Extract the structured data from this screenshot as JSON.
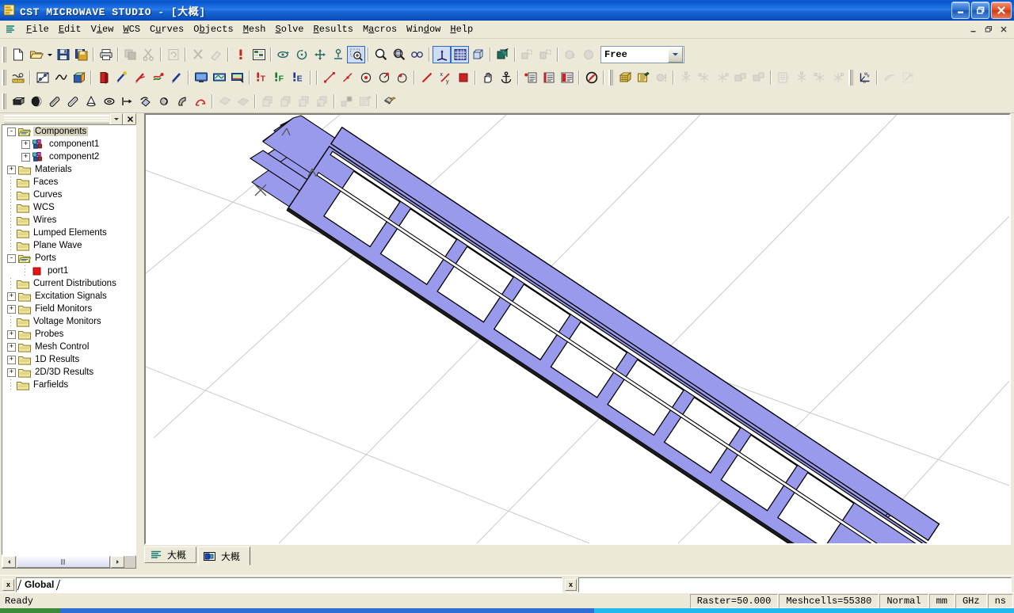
{
  "window": {
    "title": "CST MICROWAVE STUDIO - [大概]",
    "icon": "cst-logo-icon",
    "controls": {
      "minimize": "_",
      "restore": "❐",
      "close": "✕"
    },
    "mdi_controls": {
      "minimize": "_",
      "restore": "❐",
      "close": "✕"
    }
  },
  "menubar": {
    "sys_icon": "cst-document-icon",
    "items": [
      {
        "label": "File",
        "accel": "F"
      },
      {
        "label": "Edit",
        "accel": "E"
      },
      {
        "label": "View",
        "accel": "i"
      },
      {
        "label": "WCS",
        "accel": "W"
      },
      {
        "label": "Curves",
        "accel": "u"
      },
      {
        "label": "Objects",
        "accel": "b"
      },
      {
        "label": "Mesh",
        "accel": "M"
      },
      {
        "label": "Solve",
        "accel": "S"
      },
      {
        "label": "Results",
        "accel": "R"
      },
      {
        "label": "Macros",
        "accel": "a"
      },
      {
        "label": "Window",
        "accel": "d"
      },
      {
        "label": "Help",
        "accel": "H"
      }
    ]
  },
  "toolbar_main": {
    "buttons": [
      {
        "name": "new-file-icon",
        "tip": "New",
        "enabled": true
      },
      {
        "name": "open-file-icon",
        "tip": "Open",
        "enabled": true
      },
      {
        "name": "open-dropdown-icon",
        "tip": "Open recent",
        "enabled": true
      },
      {
        "name": "save-icon",
        "tip": "Save",
        "enabled": true
      },
      {
        "name": "save-project-icon",
        "tip": "Save project",
        "enabled": true
      },
      {
        "name": "print-icon",
        "tip": "Print",
        "enabled": true
      },
      {
        "name": "copy-view-icon",
        "tip": "Copy view",
        "enabled": false
      },
      {
        "name": "cut-icon",
        "tip": "Cut",
        "enabled": false
      },
      {
        "name": "refresh-icon",
        "tip": "Refresh",
        "enabled": false
      },
      {
        "name": "delete-icon",
        "tip": "Delete",
        "enabled": false
      },
      {
        "name": "undo-icon",
        "tip": "Undo",
        "enabled": false
      },
      {
        "name": "info-icon",
        "tip": "Information",
        "enabled": true
      },
      {
        "name": "parameter-list-icon",
        "tip": "Parametric",
        "enabled": true
      },
      {
        "name": "rotate-view-icon",
        "tip": "Rotate",
        "enabled": true
      },
      {
        "name": "rotate-plane-icon",
        "tip": "Rotate in plane",
        "enabled": true
      },
      {
        "name": "pan-view-icon",
        "tip": "Pan",
        "enabled": true
      },
      {
        "name": "zoom-scale-icon",
        "tip": "Scale",
        "enabled": true
      },
      {
        "name": "zoom-region-icon",
        "tip": "Zoom region",
        "enabled": true,
        "selected": true
      },
      {
        "name": "zoom-in-icon",
        "tip": "Zoom in",
        "enabled": true
      },
      {
        "name": "zoom-reset-icon",
        "tip": "Reset view",
        "enabled": true
      },
      {
        "name": "stereo-view-icon",
        "tip": "Stereo",
        "enabled": true
      },
      {
        "name": "axes-icon",
        "tip": "Show axes",
        "enabled": true,
        "selected": true
      },
      {
        "name": "grid-icon",
        "tip": "Working plane",
        "enabled": true,
        "selected": true
      },
      {
        "name": "wireframe-icon",
        "tip": "Wire frame",
        "enabled": true
      },
      {
        "name": "cutplane-icon",
        "tip": "Cutting plane",
        "enabled": true
      },
      {
        "name": "group-icon",
        "tip": "Group",
        "enabled": false
      },
      {
        "name": "ungroup-icon",
        "tip": "Ungroup",
        "enabled": false
      },
      {
        "name": "transparent-icon",
        "tip": "Transparency",
        "enabled": false
      },
      {
        "name": "shaded-icon",
        "tip": "Shaded view",
        "enabled": false
      }
    ],
    "snap_combo": {
      "value": "Free",
      "label": "snap-mode"
    }
  },
  "toolbar_simulation": {
    "buttons": [
      {
        "name": "measure-distance-icon",
        "enabled": true
      },
      {
        "name": "background-material-icon",
        "enabled": true
      },
      {
        "name": "frequency-range-icon",
        "enabled": true
      },
      {
        "name": "boundary-conditions-icon",
        "enabled": true
      },
      {
        "name": "waveguide-port-icon",
        "enabled": true
      },
      {
        "name": "discrete-port-icon",
        "enabled": true
      },
      {
        "name": "plane-wave-icon",
        "enabled": true
      },
      {
        "name": "field-source-icon",
        "enabled": true
      },
      {
        "name": "lumped-element-icon",
        "enabled": true
      },
      {
        "name": "transient-solver-icon",
        "enabled": true
      },
      {
        "name": "frequency-solver-icon",
        "enabled": true
      },
      {
        "name": "eigenmode-solver-icon",
        "enabled": true
      },
      {
        "name": "time-monitor-icon",
        "label": "T",
        "enabled": true
      },
      {
        "name": "frequency-monitor-icon",
        "label": "F",
        "enabled": true
      },
      {
        "name": "efield-monitor-icon",
        "label": "E",
        "enabled": true
      },
      {
        "name": "pick-line-icon",
        "enabled": true
      },
      {
        "name": "pick-edge-icon",
        "enabled": true
      },
      {
        "name": "pick-circle-center-icon",
        "enabled": true
      },
      {
        "name": "pick-circle-icon",
        "enabled": true
      },
      {
        "name": "pick-face-icon",
        "enabled": true
      },
      {
        "name": "align-wcs-icon",
        "enabled": true
      },
      {
        "name": "wcs-ratio-icon",
        "enabled": true
      },
      {
        "name": "pick-point-icon",
        "enabled": true
      },
      {
        "name": "move-wcs-icon",
        "enabled": true
      },
      {
        "name": "anchor-wcs-icon",
        "enabled": true
      },
      {
        "name": "list-add-icon",
        "enabled": true
      },
      {
        "name": "list-show-icon",
        "enabled": true
      },
      {
        "name": "list-clear-icon",
        "enabled": true
      },
      {
        "name": "clear-picks-icon",
        "enabled": true
      },
      {
        "name": "mesh-view-icon",
        "enabled": true
      },
      {
        "name": "mesh-properties-icon",
        "enabled": true
      },
      {
        "name": "mesh-warning-icon",
        "enabled": false
      },
      {
        "name": "local-mesh-icon",
        "enabled": false
      },
      {
        "name": "mesh-refine-icon",
        "enabled": false
      },
      {
        "name": "mesh-group-icon",
        "enabled": false
      },
      {
        "name": "mesh-snap1-icon",
        "enabled": false
      },
      {
        "name": "mesh-snap2-icon",
        "enabled": false
      },
      {
        "name": "mesh-list-icon",
        "enabled": false
      },
      {
        "name": "mesh-edit1-icon",
        "enabled": false
      },
      {
        "name": "mesh-edit2-icon",
        "enabled": false
      },
      {
        "name": "mesh-edit3-icon",
        "enabled": false
      },
      {
        "name": "wcs-local-icon",
        "enabled": true
      },
      {
        "name": "curve-export-icon",
        "enabled": false
      },
      {
        "name": "curve-extrude-icon",
        "enabled": false
      }
    ]
  },
  "toolbar_shapes": {
    "buttons": [
      {
        "name": "brick-icon",
        "enabled": true
      },
      {
        "name": "sphere-icon",
        "enabled": true
      },
      {
        "name": "cylinder-icon",
        "enabled": true
      },
      {
        "name": "ecylinder-icon",
        "enabled": true
      },
      {
        "name": "cone-icon",
        "enabled": true
      },
      {
        "name": "torus-icon",
        "enabled": true
      },
      {
        "name": "extrude-icon",
        "enabled": true
      },
      {
        "name": "rotate-shape-icon",
        "enabled": true
      },
      {
        "name": "loft-icon",
        "enabled": true
      },
      {
        "name": "trace-icon",
        "enabled": true
      },
      {
        "name": "bondwire-icon",
        "enabled": true
      },
      {
        "name": "import-curve-icon",
        "enabled": false
      },
      {
        "name": "cover-curve-icon",
        "enabled": false
      },
      {
        "name": "boolean-add-icon",
        "enabled": false
      },
      {
        "name": "boolean-subtract-icon",
        "enabled": false
      },
      {
        "name": "boolean-intersect-icon",
        "enabled": false
      },
      {
        "name": "boolean-insert-icon",
        "enabled": false
      },
      {
        "name": "transform-icon",
        "enabled": false
      },
      {
        "name": "shape-properties-icon",
        "enabled": false
      },
      {
        "name": "material-icon",
        "enabled": true
      }
    ]
  },
  "navigation_tree": {
    "header": {
      "close_label": "x",
      "dropdown_label": "▾"
    },
    "items": [
      {
        "label": "Components",
        "depth": 0,
        "expander": "-",
        "icon": "folder-open-icon",
        "selected": true
      },
      {
        "label": "component1",
        "depth": 1,
        "expander": "+",
        "icon": "component-icon"
      },
      {
        "label": "component2",
        "depth": 1,
        "expander": "+",
        "icon": "component-icon"
      },
      {
        "label": "Materials",
        "depth": 0,
        "expander": "+",
        "icon": "folder-icon"
      },
      {
        "label": "Faces",
        "depth": 0,
        "expander": "",
        "icon": "folder-icon"
      },
      {
        "label": "Curves",
        "depth": 0,
        "expander": "",
        "icon": "folder-icon"
      },
      {
        "label": "WCS",
        "depth": 0,
        "expander": "",
        "icon": "folder-icon"
      },
      {
        "label": "Wires",
        "depth": 0,
        "expander": "",
        "icon": "folder-icon"
      },
      {
        "label": "Lumped Elements",
        "depth": 0,
        "expander": "",
        "icon": "folder-icon"
      },
      {
        "label": "Plane Wave",
        "depth": 0,
        "expander": "",
        "icon": "folder-icon"
      },
      {
        "label": "Ports",
        "depth": 0,
        "expander": "-",
        "icon": "folder-open-icon"
      },
      {
        "label": "port1",
        "depth": 1,
        "expander": "",
        "icon": "port-icon"
      },
      {
        "label": "Current Distributions",
        "depth": 0,
        "expander": "",
        "icon": "folder-icon"
      },
      {
        "label": "Excitation Signals",
        "depth": 0,
        "expander": "+",
        "icon": "folder-icon"
      },
      {
        "label": "Field Monitors",
        "depth": 0,
        "expander": "+",
        "icon": "folder-icon"
      },
      {
        "label": "Voltage Monitors",
        "depth": 0,
        "expander": "",
        "icon": "folder-icon"
      },
      {
        "label": "Probes",
        "depth": 0,
        "expander": "+",
        "icon": "folder-icon"
      },
      {
        "label": "Mesh Control",
        "depth": 0,
        "expander": "+",
        "icon": "folder-icon"
      },
      {
        "label": "1D Results",
        "depth": 0,
        "expander": "+",
        "icon": "folder-icon"
      },
      {
        "label": "2D/3D Results",
        "depth": 0,
        "expander": "+",
        "icon": "folder-icon"
      },
      {
        "label": "Farfields",
        "depth": 0,
        "expander": "",
        "icon": "folder-icon"
      }
    ],
    "scrollbar": {
      "left_arrow": "◄",
      "right_arrow": "►"
    }
  },
  "view": {
    "background": "#ffffff",
    "structure_color": "#9a9aec",
    "outline_color": "#000000",
    "grid_color": "#c8c8c8",
    "axis_marker": "x"
  },
  "view_tabs": [
    {
      "label": "大概",
      "icon": "schematic-icon",
      "active": false
    },
    {
      "label": "大概",
      "icon": "model-3d-icon",
      "active": true
    }
  ],
  "message_bar": {
    "close_label": "x",
    "global_tab": "Global"
  },
  "statusbar": {
    "ready": "Ready",
    "cells": [
      {
        "name": "raster",
        "text": "Raster=50.000"
      },
      {
        "name": "meshcells",
        "text": "Meshcells=55380"
      },
      {
        "name": "mode",
        "text": "Normal"
      },
      {
        "name": "length-unit",
        "text": "mm"
      },
      {
        "name": "freq-unit",
        "text": "GHz"
      },
      {
        "name": "time-unit",
        "text": "ns"
      }
    ]
  }
}
